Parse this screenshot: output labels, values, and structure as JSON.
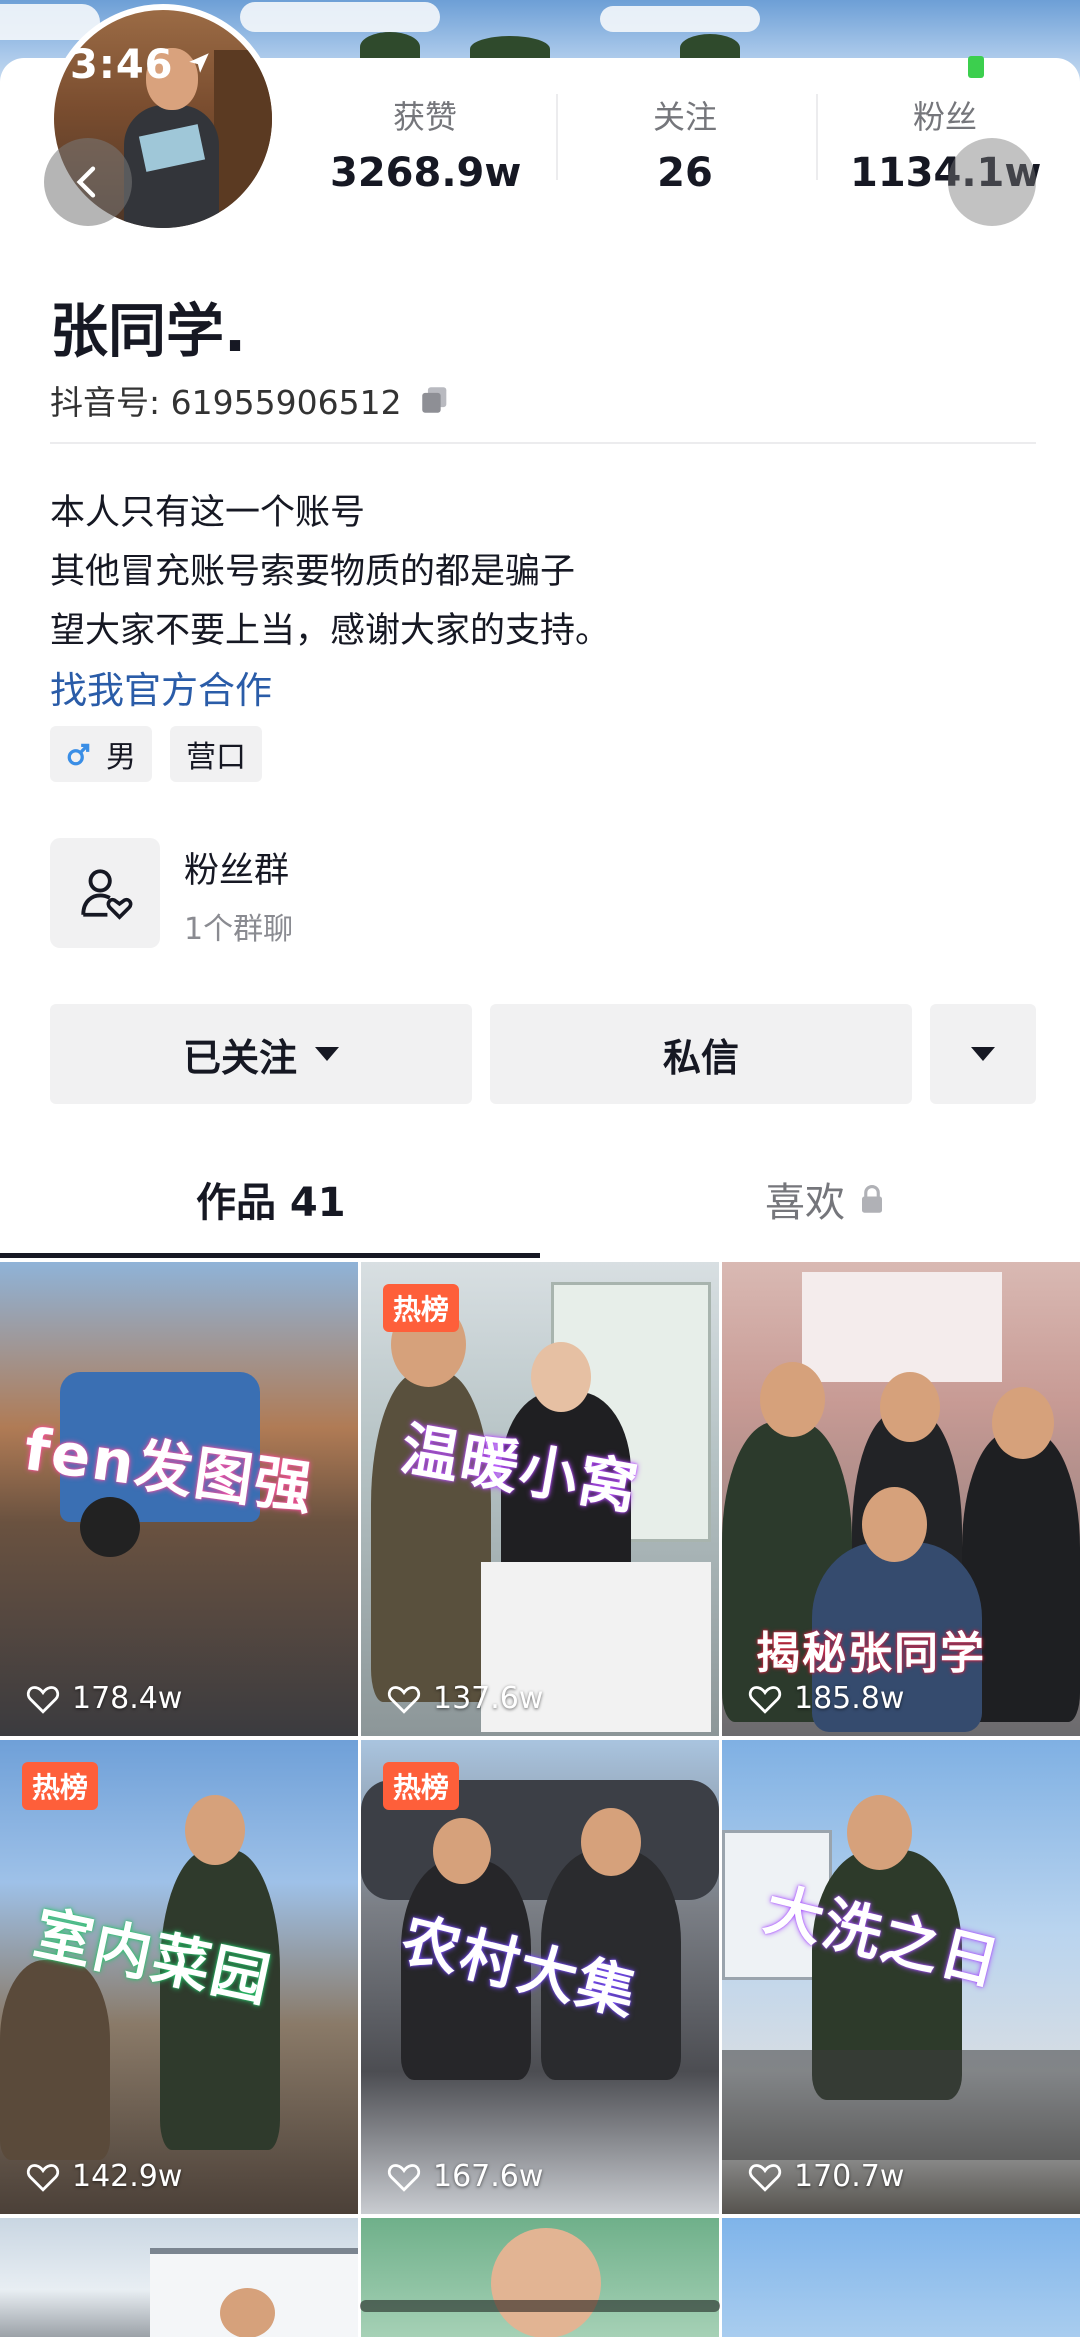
{
  "status_bar": {
    "time": "3:46"
  },
  "stats": [
    {
      "label": "获赞",
      "value": "3268.9w"
    },
    {
      "label": "关注",
      "value": "26"
    },
    {
      "label": "粉丝",
      "value": "1134.1w"
    }
  ],
  "profile": {
    "name": "张同学.",
    "douyin_id": "抖音号: 61955906512",
    "bio": [
      "本人只有这一个账号",
      "其他冒充账号索要物质的都是骗子",
      "望大家不要上当，感谢大家的支持。"
    ],
    "cooperate_link": "找我官方合作",
    "tags": {
      "gender": "男",
      "location": "营口"
    }
  },
  "fan_group": {
    "title": "粉丝群",
    "subtitle": "1个群聊"
  },
  "actions": {
    "followed": "已关注",
    "message": "私信"
  },
  "tabs": {
    "works": "作品 41",
    "likes": "喜欢"
  },
  "videos": [
    {
      "caption": "fen发图强",
      "likes": "178.4w",
      "hot": ""
    },
    {
      "caption": "温暖小窝",
      "likes": "137.6w",
      "hot": "热榜"
    },
    {
      "caption": "揭秘张同学",
      "likes": "185.8w",
      "hot": ""
    },
    {
      "caption": "室内菜园",
      "likes": "142.9w",
      "hot": "热榜"
    },
    {
      "caption": "农村大集",
      "likes": "167.6w",
      "hot": "热榜"
    },
    {
      "caption": "大洗之日",
      "likes": "170.7w",
      "hot": ""
    }
  ],
  "colors": {
    "accent_link": "#2a5ca8",
    "hot_badge": "#fe5f3a",
    "gender_icon": "#3a8ee6"
  }
}
